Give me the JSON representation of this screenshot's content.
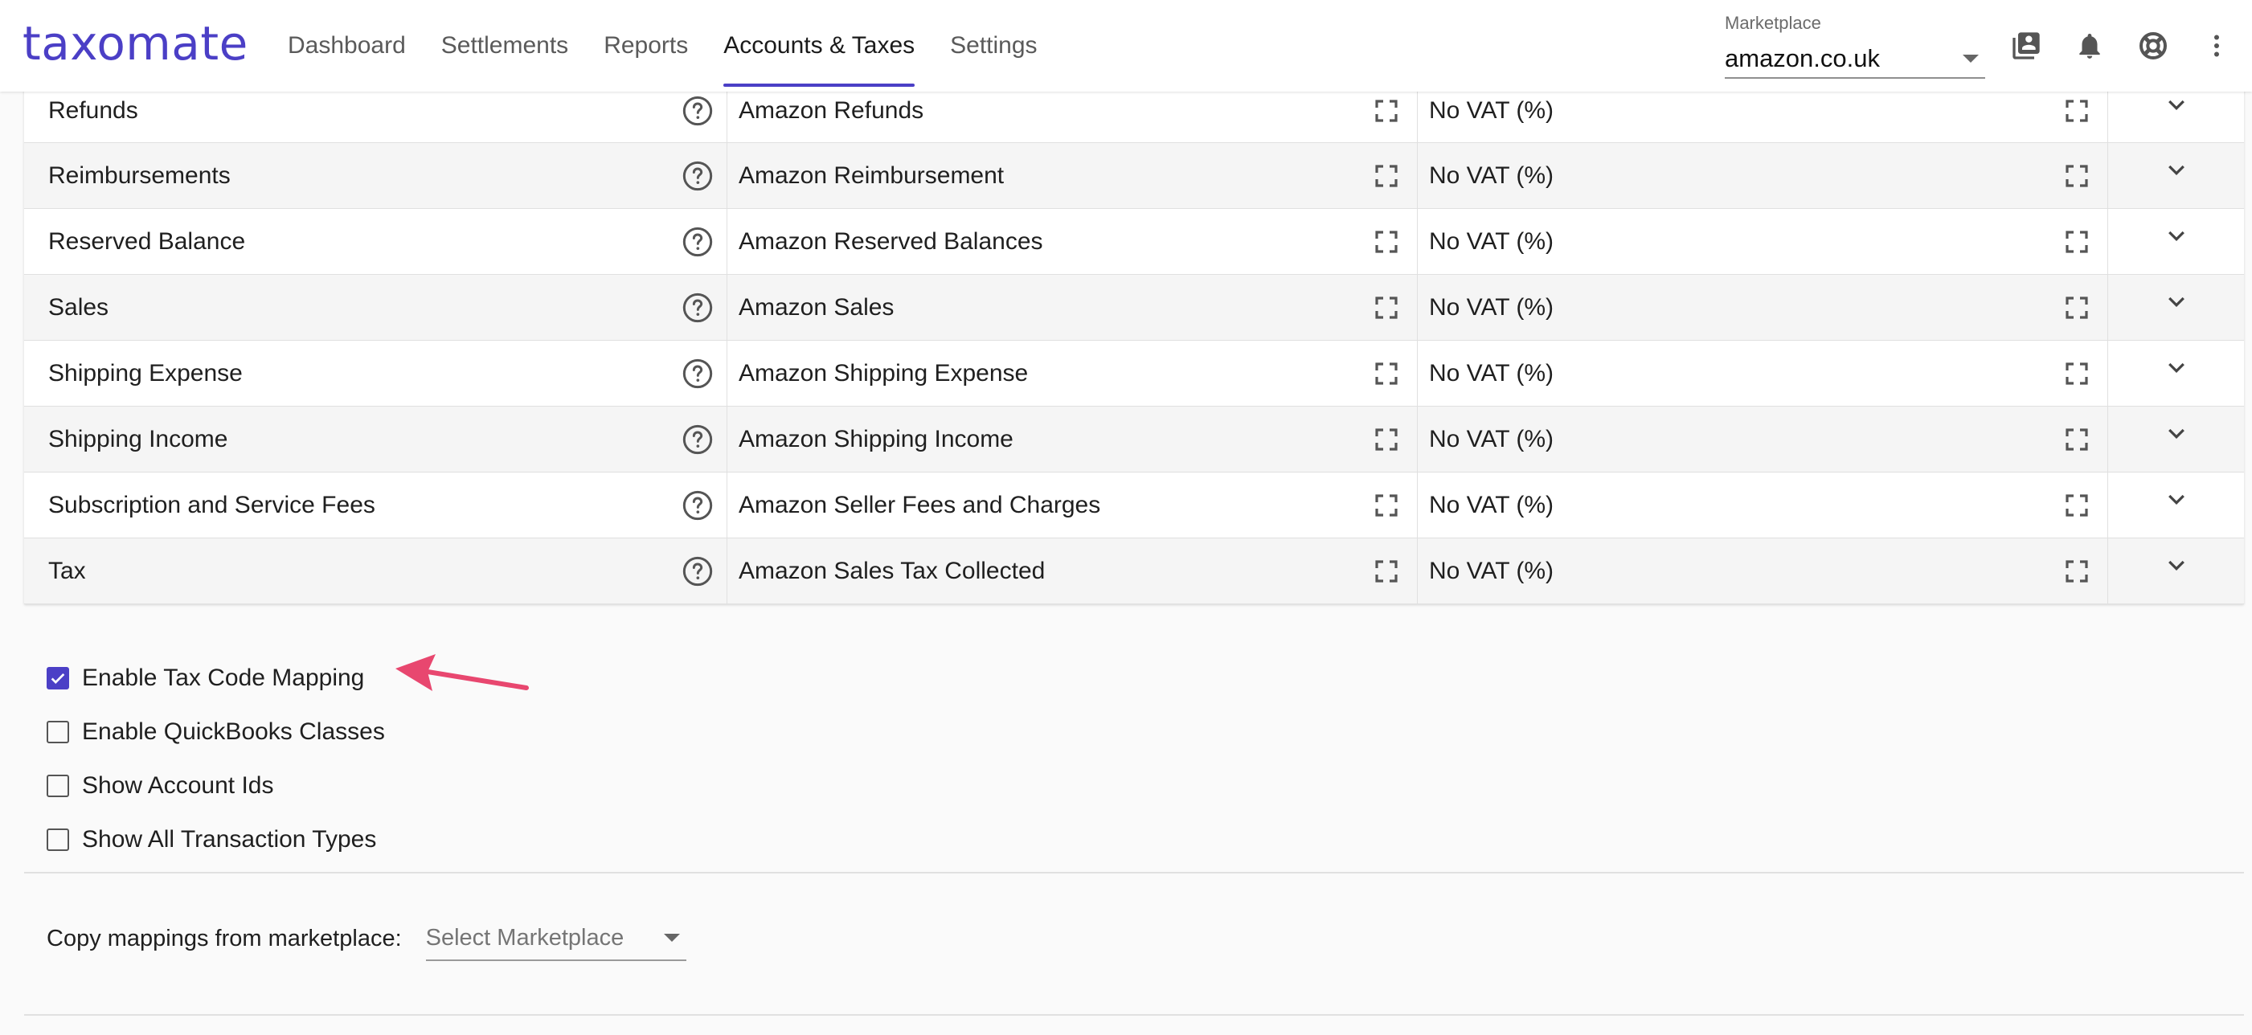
{
  "brand": {
    "logo_text": "taxomate",
    "accent": "#4b3fc6"
  },
  "nav": [
    {
      "label": "Dashboard",
      "active": false
    },
    {
      "label": "Settlements",
      "active": false
    },
    {
      "label": "Reports",
      "active": false
    },
    {
      "label": "Accounts & Taxes",
      "active": true
    },
    {
      "label": "Settings",
      "active": false
    }
  ],
  "marketplace": {
    "label": "Marketplace",
    "value": "amazon.co.uk"
  },
  "header_icons": [
    "contacts-book-icon",
    "bell-icon",
    "lifebuoy-icon",
    "more-vert-icon"
  ],
  "rows": [
    {
      "type": "Refunds",
      "account": "Amazon Refunds",
      "tax": "No VAT (%)"
    },
    {
      "type": "Reimbursements",
      "account": "Amazon Reimbursement",
      "tax": "No VAT (%)"
    },
    {
      "type": "Reserved Balance",
      "account": "Amazon Reserved Balances",
      "tax": "No VAT (%)"
    },
    {
      "type": "Sales",
      "account": "Amazon Sales",
      "tax": "No VAT (%)"
    },
    {
      "type": "Shipping Expense",
      "account": "Amazon Shipping Expense",
      "tax": "No VAT (%)"
    },
    {
      "type": "Shipping Income",
      "account": "Amazon Shipping Income",
      "tax": "No VAT (%)"
    },
    {
      "type": "Subscription and Service Fees",
      "account": "Amazon Seller Fees and Charges",
      "tax": "No VAT (%)"
    },
    {
      "type": "Tax",
      "account": "Amazon Sales Tax Collected",
      "tax": "No VAT (%)"
    }
  ],
  "options": [
    {
      "label": "Enable Tax Code Mapping",
      "checked": true
    },
    {
      "label": "Enable QuickBooks Classes",
      "checked": false
    },
    {
      "label": "Show Account Ids",
      "checked": false
    },
    {
      "label": "Show All Transaction Types",
      "checked": false
    }
  ],
  "annotation_arrow_color": "#e8476f",
  "copy": {
    "label": "Copy mappings from marketplace:",
    "placeholder": "Select Marketplace"
  }
}
